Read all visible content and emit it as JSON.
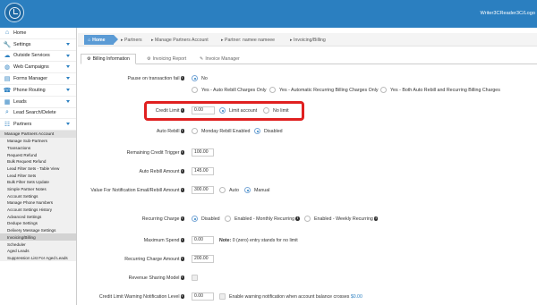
{
  "header": {
    "user_path": "Writer3CReader3C/Logo"
  },
  "sidebar": {
    "items": [
      {
        "label": "Home",
        "icon": "home-icon"
      },
      {
        "label": "Settings",
        "icon": "wrench-icon"
      },
      {
        "label": "Outside Services",
        "icon": "cloud-icon"
      },
      {
        "label": "Web Campaigns",
        "icon": "globe-icon"
      },
      {
        "label": "Forms Manager",
        "icon": "form-icon"
      },
      {
        "label": "Phone Routing",
        "icon": "phone-icon"
      },
      {
        "label": "Leads",
        "icon": "leads-icon"
      },
      {
        "label": "Lead Search/Delete",
        "icon": "search-icon"
      },
      {
        "label": "Partners",
        "icon": "partners-icon"
      }
    ],
    "sub_items": [
      "Manage Partners Account",
      "Manage Sub-Partners",
      "Transactions",
      "Request Refund",
      "Bulk Request Refund",
      "Lead Filter Sets - Table View",
      "Lead Filter Sets",
      "Bulk Filter Sets Update",
      "Simple Partner Notes",
      "Account Settings",
      "Manage Phone Numbers",
      "Account Settings History",
      "Advanced Settings",
      "Dedupe Settings",
      "Delivery Message Settings",
      "Invoicing/Billing",
      "Scheduler",
      "Aged Leads",
      "Suppression List For Aged Leads"
    ]
  },
  "breadcrumb": {
    "home": "Home",
    "items": [
      "Partners",
      "Manage Partners Account",
      "Partner: namee nameee",
      "Invoicing/Billing"
    ]
  },
  "tabs": [
    "Billing Information",
    "Invoicing Report",
    "Invoice Manager"
  ],
  "form": {
    "pause": {
      "label": "Pause on transaction fail",
      "options": [
        "No",
        "Yes - Auto Rebill Charges Only",
        "Yes - Automatic Recurring Billing Charges Only",
        "Yes - Both Auto Rebill and Recurring Billing Charges"
      ]
    },
    "credit_limit": {
      "label": "Credit Limit",
      "value": "0.00",
      "opt1": "Limit account",
      "opt2": "No limit"
    },
    "auto_rebill": {
      "label": "Auto Rebill",
      "opt1": "Monday Rebill Enabled",
      "opt2": "Disabled"
    },
    "remaining_trigger": {
      "label": "Remaining Credit Trigger",
      "value": "100.00"
    },
    "auto_rebill_amount": {
      "label": "Auto Rebill Amount",
      "value": "145.00"
    },
    "notif_value": {
      "label": "Value For Notification Email/Rebill Amount",
      "value": "300.00",
      "opt1": "Auto",
      "opt2": "Manual"
    },
    "recurring_charge": {
      "label": "Recurring Charge",
      "opt1": "Disabled",
      "opt2": "Enabled - Monthly Recurring",
      "opt3": "Enabled - Weekly Recurring"
    },
    "max_spend": {
      "label": "Maximum Spend",
      "value": "0.00",
      "note_bold": "Note:",
      "note": "0 (zero) entry stands for no limit"
    },
    "recurring_amount": {
      "label": "Recurring Charge Amount",
      "value": "200.00"
    },
    "revenue_sharing": {
      "label": "Revenue Sharing Model"
    },
    "warning_level": {
      "label": "Credit Limit Warning Notification Level",
      "value": "0.00",
      "text": "Enable warning notification when account balance crosses",
      "amount": "$0.00"
    }
  },
  "colors": {
    "topbar": "#2b7fc0",
    "accent": "#2b7fc0",
    "highlight": "#e02020"
  }
}
